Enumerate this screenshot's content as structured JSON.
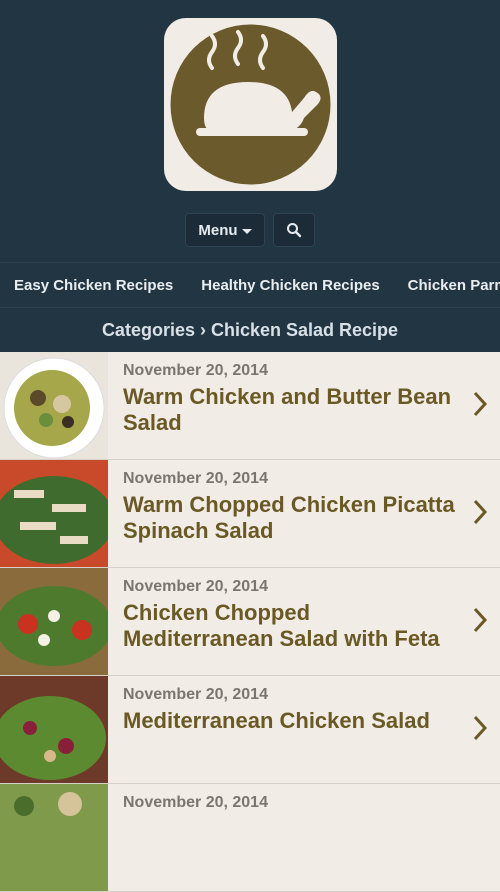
{
  "header": {
    "logo_icon": "roast-chicken-logo-icon",
    "menu_label": "Menu",
    "search_icon": "search-icon"
  },
  "categories": [
    "Easy Chicken Recipes",
    "Healthy Chicken Recipes",
    "Chicken Parmesan"
  ],
  "breadcrumb": "Categories › Chicken Salad Recipe",
  "posts": [
    {
      "date": "November 20, 2014",
      "title": "Warm Chicken and Butter Bean Salad"
    },
    {
      "date": "November 20, 2014",
      "title": "Warm Chopped Chicken Picatta Spinach Salad"
    },
    {
      "date": "November 20, 2014",
      "title": "Chicken Chopped Mediterranean Salad with Feta"
    },
    {
      "date": "November 20, 2014",
      "title": "Mediterranean Chicken Salad"
    },
    {
      "date": "November 20, 2014",
      "title": ""
    }
  ],
  "colors": {
    "header_bg": "#213543",
    "list_bg": "#f1ede6",
    "title_color": "#6a5925",
    "logo_brown": "#6b5a2b"
  }
}
